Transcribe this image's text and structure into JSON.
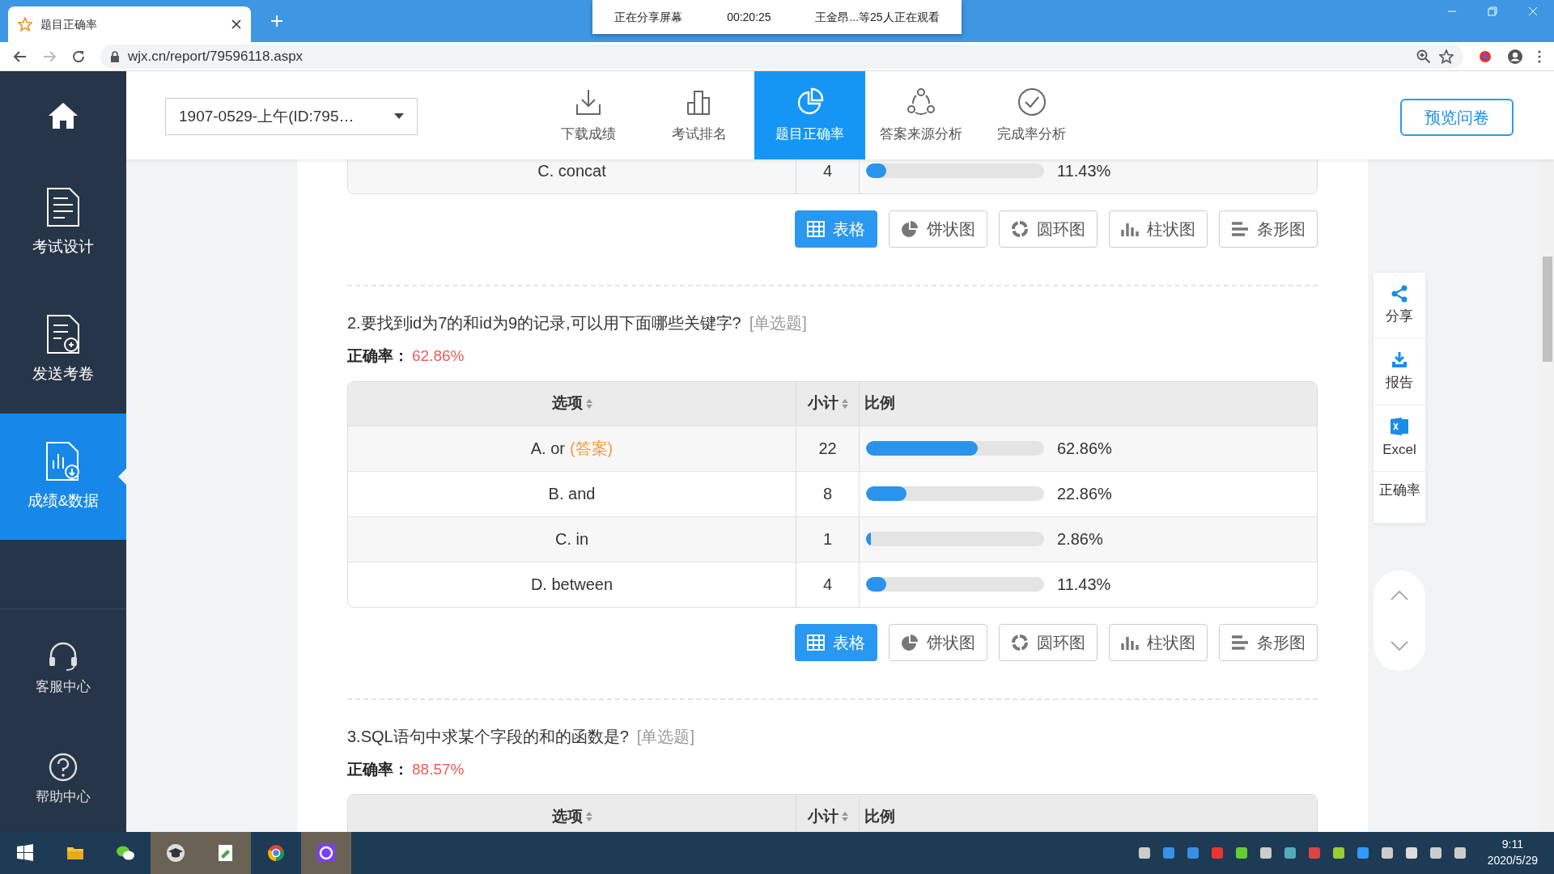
{
  "browser": {
    "tab_title": "题目正确率",
    "url": "wjx.cn/report/79596118.aspx"
  },
  "share_banner": {
    "status": "正在分享屏幕",
    "timer": "00:20:25",
    "viewers": "王金昂...等25人正在观看"
  },
  "sidebar": [
    {
      "kind": "home",
      "selected": false
    },
    {
      "kind": "design",
      "label": "考试设计",
      "selected": false
    },
    {
      "kind": "send",
      "label": "发送考卷",
      "selected": false
    },
    {
      "kind": "data",
      "label": "成绩&数据",
      "selected": true
    },
    {
      "kind": "service",
      "label": "客服中心",
      "selected": false
    },
    {
      "kind": "help",
      "label": "帮助中心",
      "selected": false
    }
  ],
  "header": {
    "survey_select": "1907-0529-上午(ID:795…",
    "preview_button": "预览问卷",
    "nav": [
      {
        "kind": "download",
        "label": "下载成绩",
        "selected": false
      },
      {
        "kind": "rank",
        "label": "考试排名",
        "selected": false
      },
      {
        "kind": "accuracy",
        "label": "题目正确率",
        "selected": true
      },
      {
        "kind": "source",
        "label": "答案来源分析",
        "selected": false
      },
      {
        "kind": "completion",
        "label": "完成率分析",
        "selected": false
      }
    ]
  },
  "questions": [
    {
      "rows": [
        {
          "option": "C. concat",
          "count": "4",
          "level": 0.1143,
          "percent": "11.43%"
        }
      ],
      "chart_buttons": [
        {
          "kind": "table",
          "label": "表格",
          "selected": true
        },
        {
          "kind": "pie",
          "label": "饼状图",
          "selected": false
        },
        {
          "kind": "donut",
          "label": "圆环图",
          "selected": false
        },
        {
          "kind": "column",
          "label": "柱状图",
          "selected": false
        },
        {
          "kind": "bar",
          "label": "条形图",
          "selected": false
        }
      ]
    },
    {
      "title": "2.要找到id为7的和id为9的记录,可以用下面哪些关键字?",
      "type_tag": "[单选题]",
      "accuracy_label": "正确率：",
      "accuracy": "62.86%",
      "columns": [
        {
          "label": "选项",
          "sortable": true
        },
        {
          "label": "小计",
          "sortable": true
        },
        {
          "label": "比例",
          "sortable": false
        }
      ],
      "rows": [
        {
          "option": "A. or",
          "answer_tag": "(答案)",
          "count": "22",
          "level": 0.6286,
          "percent": "62.86%"
        },
        {
          "option": "B. and",
          "count": "8",
          "level": 0.2286,
          "percent": "22.86%"
        },
        {
          "option": "C. in",
          "count": "1",
          "level": 0.0286,
          "percent": "2.86%"
        },
        {
          "option": "D. between",
          "count": "4",
          "level": 0.1143,
          "percent": "11.43%"
        }
      ],
      "chart_buttons": [
        {
          "kind": "table",
          "label": "表格",
          "selected": true
        },
        {
          "kind": "pie",
          "label": "饼状图",
          "selected": false
        },
        {
          "kind": "donut",
          "label": "圆环图",
          "selected": false
        },
        {
          "kind": "column",
          "label": "柱状图",
          "selected": false
        },
        {
          "kind": "bar",
          "label": "条形图",
          "selected": false
        }
      ]
    },
    {
      "title": "3.SQL语句中求某个字段的和的函数是?",
      "type_tag": "[单选题]",
      "accuracy_label": "正确率：",
      "accuracy": "88.57%",
      "columns": [
        {
          "label": "选项",
          "sortable": true
        },
        {
          "label": "小计",
          "sortable": true
        },
        {
          "label": "比例",
          "sortable": false
        }
      ]
    }
  ],
  "side_tools": [
    {
      "kind": "share",
      "label": "分享"
    },
    {
      "kind": "report",
      "label": "报告"
    },
    {
      "kind": "excel",
      "label": "Excel"
    },
    {
      "kind": "text",
      "label": "正确率"
    }
  ],
  "taskbar": {
    "time": "9:11",
    "date": "2020/5/29"
  }
}
